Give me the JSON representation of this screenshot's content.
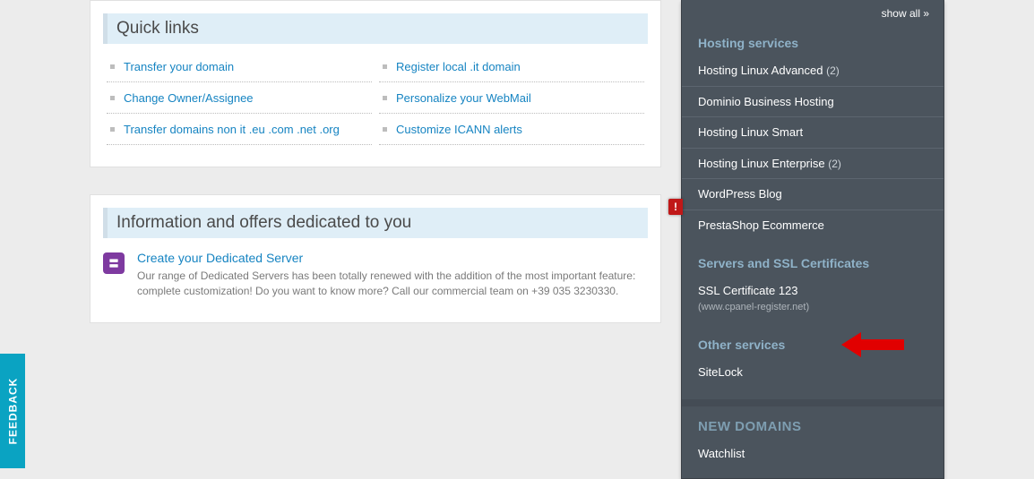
{
  "quick_links": {
    "title": "Quick links",
    "left": [
      "Transfer your domain",
      "Change Owner/Assignee",
      "Transfer domains non it .eu .com .net .org"
    ],
    "right": [
      "Register local .it domain",
      "Personalize your WebMail",
      "Customize ICANN alerts"
    ]
  },
  "offers": {
    "title": "Information and offers dedicated to you",
    "item_title": "Create your Dedicated Server",
    "item_desc": "Our range of Dedicated Servers has been totally renewed with the addition of the most important feature: complete customization! Do you want to know more? Call our commercial team on +39 035 3230330."
  },
  "sidebar": {
    "show_all": "show all »",
    "hosting_title": "Hosting services",
    "hosting_items": [
      {
        "label": "Hosting Linux Advanced",
        "badge": "(2)"
      },
      {
        "label": "Dominio Business Hosting",
        "badge": ""
      },
      {
        "label": "Hosting Linux Smart",
        "badge": ""
      },
      {
        "label": "Hosting Linux Enterprise",
        "badge": "(2)"
      },
      {
        "label": "WordPress Blog",
        "badge": ""
      },
      {
        "label": "PrestaShop Ecommerce",
        "badge": ""
      }
    ],
    "servers_title": "Servers and SSL Certificates",
    "ssl_label": "SSL Certificate 123",
    "ssl_sub": "(www.cpanel-register.net)",
    "other_title": "Other services",
    "sitelock": "SiteLock",
    "new_domains_title": "NEW DOMAINS",
    "watchlist": "Watchlist"
  },
  "feedback": "FEEDBACK",
  "alert_glyph": "!"
}
